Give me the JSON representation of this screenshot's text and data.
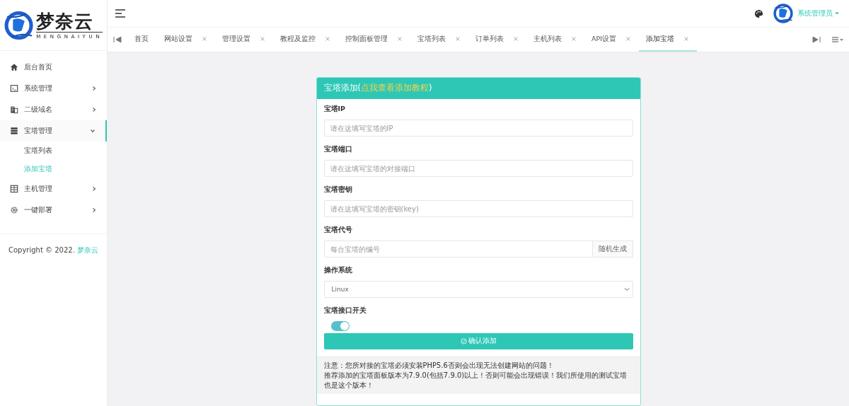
{
  "brand": {
    "name": "梦奈云",
    "subtitle": "MENGNAIYUN"
  },
  "header": {
    "user": "系统管理员"
  },
  "tabs": [
    {
      "label": "首页",
      "closable": false,
      "selected": false
    },
    {
      "label": "网站设置",
      "closable": true,
      "selected": false
    },
    {
      "label": "管理设置",
      "closable": true,
      "selected": false
    },
    {
      "label": "教程及监控",
      "closable": true,
      "selected": false
    },
    {
      "label": "控制面板管理",
      "closable": true,
      "selected": false
    },
    {
      "label": "宝塔列表",
      "closable": true,
      "selected": false
    },
    {
      "label": "订单列表",
      "closable": true,
      "selected": false
    },
    {
      "label": "主机列表",
      "closable": true,
      "selected": false
    },
    {
      "label": "API设置",
      "closable": true,
      "selected": false
    },
    {
      "label": "添加宝塔",
      "closable": true,
      "selected": true
    }
  ],
  "sidebar": {
    "items": [
      {
        "label": "后台首页",
        "has_children": false,
        "selected": false
      },
      {
        "label": "系统管理",
        "has_children": true,
        "expanded": false,
        "selected": false
      },
      {
        "label": "二级域名",
        "has_children": true,
        "expanded": false,
        "selected": false
      },
      {
        "label": "宝塔管理",
        "has_children": true,
        "expanded": true,
        "selected": true,
        "children": [
          {
            "label": "宝塔列表",
            "selected": false
          },
          {
            "label": "添加宝塔",
            "selected": true
          }
        ]
      },
      {
        "label": "主机管理",
        "has_children": true,
        "expanded": false,
        "selected": false
      },
      {
        "label": "一键部署",
        "has_children": true,
        "expanded": false,
        "selected": false
      }
    ],
    "copyright": "Copyright © 2022.",
    "copyright_link": "梦奈云"
  },
  "form": {
    "title_before": "宝塔添加(",
    "title_link": "点我查看添加教程",
    "title_after": ")",
    "fields": [
      {
        "kind": "text",
        "label": "宝塔IP",
        "placeholder": "请在这填写宝塔的IP"
      },
      {
        "kind": "text",
        "label": "宝塔端口",
        "placeholder": "请在这填写宝塔的对接端口"
      },
      {
        "kind": "text",
        "label": "宝塔密钥",
        "placeholder": "请在这填写宝塔的密钥(key)"
      },
      {
        "kind": "addon",
        "label": "宝塔代号",
        "placeholder": "每台宝塔的编号",
        "addon": "随机生成"
      },
      {
        "kind": "select",
        "label": "操作系统",
        "value": "Linux"
      },
      {
        "kind": "switch",
        "label": "宝塔接口开关",
        "on": true
      }
    ],
    "submit": "确认添加",
    "notes": [
      "注意：您所对接的宝塔必须安装PHP5.6否则会出现无法创建网站的问题！",
      "推荐添加的宝塔面板版本为7.9.0(包括7.9.0)以上！否则可能会出现错误！我们所使用的测试宝塔也是这个版本！"
    ]
  }
}
